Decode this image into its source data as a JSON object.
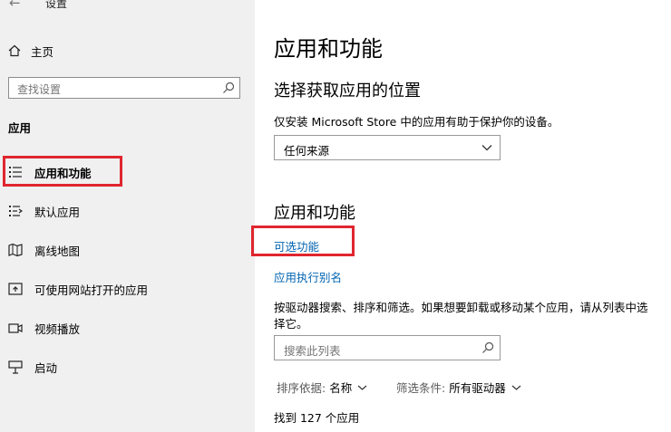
{
  "window": {
    "title": "设置"
  },
  "sidebar": {
    "home_label": "主页",
    "search_placeholder": "查找设置",
    "section_heading": "应用",
    "items": [
      {
        "label": "应用和功能",
        "icon": "apps-features-icon",
        "selected": true
      },
      {
        "label": "默认应用",
        "icon": "default-apps-icon"
      },
      {
        "label": "离线地图",
        "icon": "offline-maps-icon"
      },
      {
        "label": "可使用网站打开的应用",
        "icon": "apps-for-websites-icon"
      },
      {
        "label": "视频播放",
        "icon": "video-playback-icon"
      },
      {
        "label": "启动",
        "icon": "startup-icon"
      }
    ]
  },
  "main": {
    "title": "应用和功能",
    "install_section": {
      "heading": "选择获取应用的位置",
      "description": "仅安装 Microsoft Store 中的应用有助于保护你的设备。",
      "dropdown_value": "任何来源"
    },
    "apps_section": {
      "heading": "应用和功能",
      "optional_features_link": "可选功能",
      "app_alias_link": "应用执行别名",
      "description": "按驱动器搜索、排序和筛选。如果想要卸载或移动某个应用，请从列表中选择它。",
      "search_placeholder": "搜索此列表",
      "sort_label": "排序依据:",
      "sort_value": "名称",
      "filter_label": "筛选条件:",
      "filter_value": "所有驱动器",
      "result_count": "找到 127 个应用"
    }
  },
  "colors": {
    "highlight_box": "#e0262f",
    "link": "#0063b1",
    "sidebar_bg": "#f0f0f0"
  }
}
